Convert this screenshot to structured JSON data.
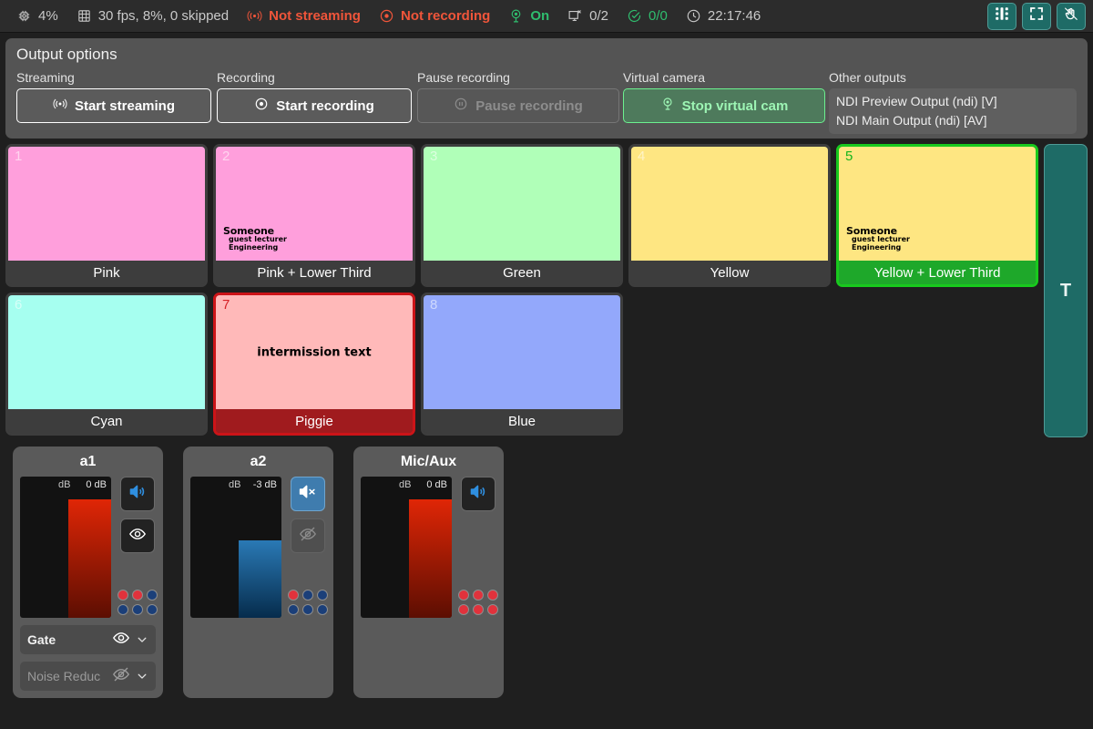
{
  "statusbar": {
    "items": [
      {
        "icon": "cpu-icon",
        "text": "4%",
        "color": "#c9c9c9"
      },
      {
        "icon": "film-icon",
        "text": "30 fps, 8%, 0 skipped",
        "color": "#c9c9c9"
      },
      {
        "icon": "broadcast-icon",
        "text": "Not streaming",
        "color": "#f0553a"
      },
      {
        "icon": "record-icon",
        "text": "Not recording",
        "color": "#f0553a"
      },
      {
        "icon": "virtualcam-icon",
        "text": "On",
        "color": "#2fbd6e"
      },
      {
        "icon": "monitor-icon",
        "text": "0/2",
        "color": "#c9c9c9"
      },
      {
        "icon": "check-icon",
        "text": "0/0",
        "color": "#2fbd6e"
      },
      {
        "icon": "clock-icon",
        "text": "22:17:46",
        "color": "#c9c9c9"
      }
    ],
    "buttons": [
      {
        "icon": "grid-layout-icon"
      },
      {
        "icon": "fullscreen-icon"
      },
      {
        "icon": "swipe-hand-icon"
      }
    ]
  },
  "outputs": {
    "title": "Output options",
    "streaming": {
      "label": "Streaming",
      "button": "Start streaming",
      "icon": "broadcast-icon"
    },
    "recording": {
      "label": "Recording",
      "button": "Start recording",
      "icon": "record-icon"
    },
    "pause": {
      "label": "Pause recording",
      "button": "Pause recording",
      "icon": "pause-icon",
      "disabled": true
    },
    "virtualcam": {
      "label": "Virtual camera",
      "button": "Stop virtual cam",
      "icon": "virtualcam-icon",
      "active": true
    },
    "other": {
      "label": "Other outputs",
      "items": [
        "NDI Preview Output (ndi)  [V]",
        "NDI Main Output (ndi)  [AV]"
      ]
    }
  },
  "scenes": [
    {
      "num": "1",
      "name": "Pink",
      "color": "#ff9fdc",
      "state": "idle",
      "overlay": "none"
    },
    {
      "num": "2",
      "name": "Pink + Lower Third",
      "color": "#ff9fdc",
      "state": "idle",
      "overlay": "lower-third"
    },
    {
      "num": "3",
      "name": "Green",
      "color": "#b0ffb8",
      "state": "idle",
      "overlay": "none"
    },
    {
      "num": "4",
      "name": "Yellow",
      "color": "#fee682",
      "state": "idle",
      "overlay": "none"
    },
    {
      "num": "5",
      "name": "Yellow + Lower Third",
      "color": "#fee682",
      "state": "preview",
      "overlay": "lower-third"
    },
    {
      "num": "6",
      "name": "Cyan",
      "color": "#a6fff0",
      "state": "idle",
      "overlay": "none"
    },
    {
      "num": "7",
      "name": "Piggie",
      "color": "#ffb9b9",
      "state": "live",
      "overlay": "center-text"
    },
    {
      "num": "8",
      "name": "Blue",
      "color": "#93a8fb",
      "state": "idle",
      "overlay": "none"
    }
  ],
  "lower_third": {
    "name": "Someone",
    "role": "guest lecturer",
    "dept": "Engineering"
  },
  "intermission_text": "intermission text",
  "transition_rail": {
    "label": "T"
  },
  "mixer": {
    "db_label": "dB",
    "channels": [
      {
        "name": "a1",
        "value": "0 dB",
        "level_pct": 84,
        "bar_color": "red",
        "muted": false,
        "mute_icon": "speaker-on-icon",
        "has_monitor": true,
        "monitor_icon": "eye-icon",
        "monitor_on": true,
        "dots": [
          "r",
          "r",
          "b",
          "b",
          "b",
          "b"
        ],
        "filters": [
          {
            "name": "Gate",
            "icon": "eye-icon",
            "enabled": true
          },
          {
            "name": "Noise Reduc",
            "icon": "eye-off-icon",
            "enabled": false
          }
        ]
      },
      {
        "name": "a2",
        "value": "-3 dB",
        "level_pct": 55,
        "bar_color": "blue",
        "muted": true,
        "mute_icon": "speaker-muted-icon",
        "has_monitor": true,
        "monitor_icon": "eye-off-icon",
        "monitor_on": false,
        "dots": [
          "r",
          "b",
          "b",
          "b",
          "b",
          "b"
        ],
        "filters": []
      },
      {
        "name": "Mic/Aux",
        "value": "0 dB",
        "level_pct": 84,
        "bar_color": "red",
        "muted": false,
        "mute_icon": "speaker-on-icon",
        "has_monitor": false,
        "monitor_icon": "",
        "monitor_on": false,
        "dots": [
          "r",
          "r",
          "r",
          "r",
          "r",
          "r"
        ],
        "filters": []
      }
    ]
  }
}
